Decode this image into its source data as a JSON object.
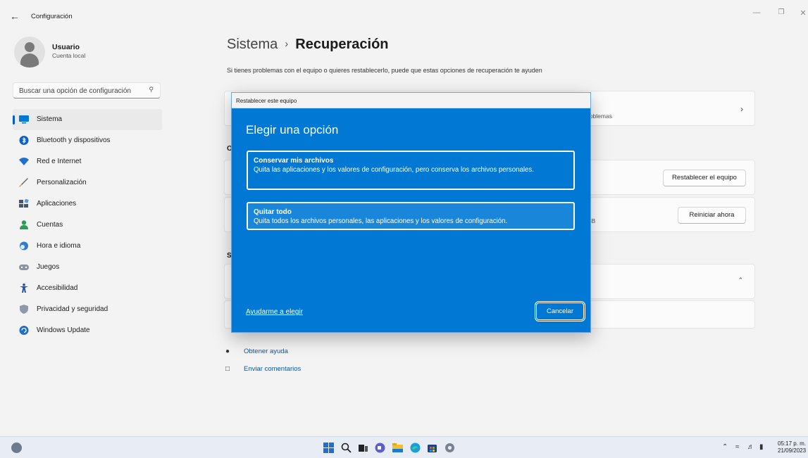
{
  "window": {
    "title": "Configuración"
  },
  "user": {
    "name": "Usuario",
    "account": "Cuenta local"
  },
  "search": {
    "placeholder": "Buscar una opción de configuración"
  },
  "nav": [
    {
      "label": "Sistema",
      "icon": "system-icon",
      "active": true
    },
    {
      "label": "Bluetooth y dispositivos",
      "icon": "bluetooth-icon"
    },
    {
      "label": "Red e Internet",
      "icon": "wifi-icon"
    },
    {
      "label": "Personalización",
      "icon": "brush-icon"
    },
    {
      "label": "Aplicaciones",
      "icon": "apps-icon"
    },
    {
      "label": "Cuentas",
      "icon": "person-icon"
    },
    {
      "label": "Hora e idioma",
      "icon": "clock-globe-icon"
    },
    {
      "label": "Juegos",
      "icon": "gamepad-icon"
    },
    {
      "label": "Accesibilidad",
      "icon": "accessibility-icon"
    },
    {
      "label": "Privacidad y seguridad",
      "icon": "shield-icon"
    },
    {
      "label": "Windows Update",
      "icon": "update-icon"
    }
  ],
  "main": {
    "breadcrumb_parent": "Sistema",
    "breadcrumb_separator": "›",
    "breadcrumb_current": "Recuperación",
    "subtitle": "Si tienes problemas con el equipo o quieres restablecerlo, puede que estas opciones de recuperación te ayuden",
    "fix_card_text": "roblemas",
    "section_c": "O",
    "reset_button": "Restablecer el equipo",
    "advanced_text": "SB",
    "restart_button": "Reiniciar ahora",
    "section_s": "S",
    "help_link": "Obtener ayuda",
    "feedback_link": "Enviar comentarios"
  },
  "dialog": {
    "title": "Restablecer este equipo",
    "heading": "Elegir una opción",
    "option1_title": "Conservar mis archivos",
    "option1_desc": "Quita las aplicaciones y los valores de configuración, pero conserva los archivos personales.",
    "option2_title": "Quitar todo",
    "option2_desc": "Quita todos los archivos personales, las aplicaciones y los valores de configuración.",
    "help_link": "Ayudarme a elegir",
    "cancel": "Cancelar"
  },
  "taskbar": {
    "time": "05:17 p. m.",
    "date": "21/09/2023"
  },
  "colors": {
    "accent": "#0078d4",
    "link": "#0a56a6"
  }
}
